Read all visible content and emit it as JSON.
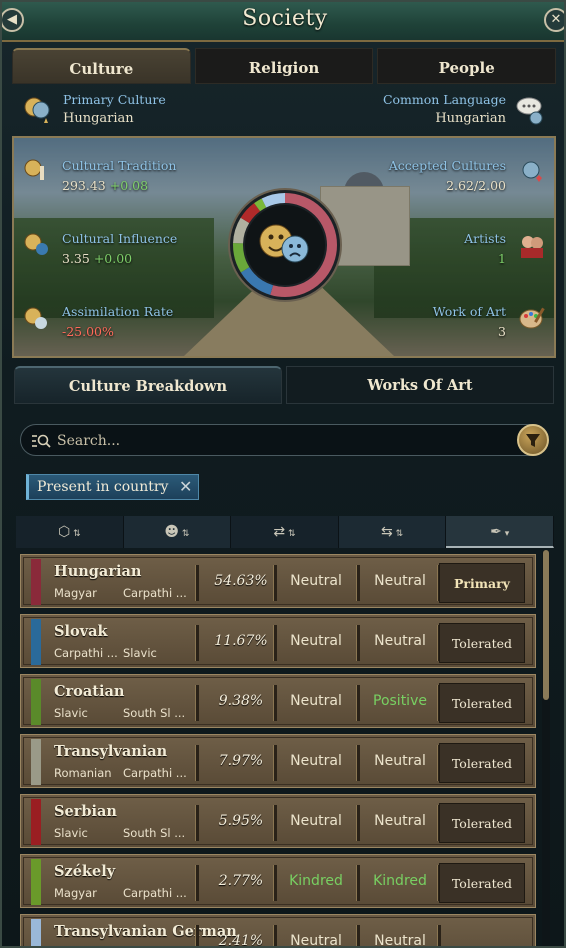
{
  "window": {
    "title": "Society"
  },
  "tabs": [
    {
      "label": "Culture",
      "active": true
    },
    {
      "label": "Religion",
      "active": false
    },
    {
      "label": "People",
      "active": false
    }
  ],
  "summary": {
    "primary_culture_label": "Primary Culture",
    "primary_culture_value": "Hungarian",
    "common_language_label": "Common Language",
    "common_language_value": "Hungarian"
  },
  "stats": {
    "cultural_tradition": {
      "label": "Cultural Tradition",
      "value": "293.43",
      "delta": "+0.08"
    },
    "cultural_influence": {
      "label": "Cultural Influence",
      "value": "3.35",
      "delta": "+0.00"
    },
    "assimilation_rate": {
      "label": "Assimilation Rate",
      "value": "-25.00%"
    },
    "accepted_cultures": {
      "label": "Accepted Cultures",
      "value": "2.62/2.00"
    },
    "artists": {
      "label": "Artists",
      "value": "1"
    },
    "work_of_art": {
      "label": "Work of Art",
      "value": "3"
    }
  },
  "breakdown_tabs": [
    {
      "label": "Culture Breakdown",
      "active": true
    },
    {
      "label": "Works Of Art",
      "active": false
    }
  ],
  "search": {
    "placeholder": "Search..."
  },
  "filter_chip": {
    "label": "Present in country"
  },
  "sort_icons": [
    "culture-group-icon",
    "heads-icon",
    "relations-icon",
    "relations-alt-icon",
    "quill-icon"
  ],
  "rows": [
    {
      "name": "Hungarian",
      "sub1": "Magyar",
      "sub2": "Carpathi ...",
      "percent": "54.63%",
      "rel1": "Neutral",
      "rel2": "Neutral",
      "status": "Primary",
      "color": "#8a2a3a"
    },
    {
      "name": "Slovak",
      "sub1": "Carpathi ...",
      "sub2": "Slavic",
      "percent": "11.67%",
      "rel1": "Neutral",
      "rel2": "Neutral",
      "status": "Tolerated",
      "color": "#2a6a9a"
    },
    {
      "name": "Croatian",
      "sub1": "Slavic",
      "sub2": "South Sl ...",
      "percent": "9.38%",
      "rel1": "Neutral",
      "rel2": "Positive",
      "status": "Tolerated",
      "color": "#5a8a2a"
    },
    {
      "name": "Transylvanian",
      "sub1": "Romanian",
      "sub2": "Carpathi ...",
      "percent": "7.97%",
      "rel1": "Neutral",
      "rel2": "Neutral",
      "status": "Tolerated",
      "color": "#9a9a88"
    },
    {
      "name": "Serbian",
      "sub1": "Slavic",
      "sub2": "South Sl ...",
      "percent": "5.95%",
      "rel1": "Neutral",
      "rel2": "Neutral",
      "status": "Tolerated",
      "color": "#9a1e22"
    },
    {
      "name": "Székely",
      "sub1": "Magyar",
      "sub2": "Carpathi ...",
      "percent": "2.77%",
      "rel1": "Kindred",
      "rel2": "Kindred",
      "status": "Tolerated",
      "color": "#6a9a2a"
    },
    {
      "name": "Transylvanian German",
      "sub1": "",
      "sub2": "",
      "percent": "2.41%",
      "rel1": "Neutral",
      "rel2": "Neutral",
      "status": "",
      "color": "#9ab8d8"
    }
  ]
}
